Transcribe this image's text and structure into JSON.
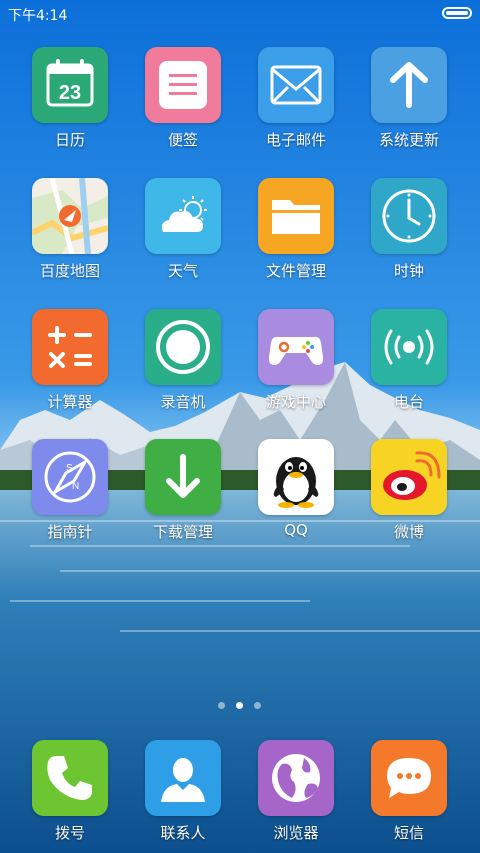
{
  "status_bar": {
    "time": "下午4:14",
    "battery_level": 1.0
  },
  "apps": [
    {
      "label": "日历",
      "icon": "calendar-icon",
      "color": "#2aa876",
      "date": "23"
    },
    {
      "label": "便签",
      "icon": "notes-icon",
      "color": "#f07b9b"
    },
    {
      "label": "电子邮件",
      "icon": "mail-icon",
      "color": "#3a9ee8"
    },
    {
      "label": "系统更新",
      "icon": "update-arrow-icon",
      "color": "#4aa0e0"
    },
    {
      "label": "百度地图",
      "icon": "map-icon",
      "color": "#ffffff"
    },
    {
      "label": "天气",
      "icon": "weather-icon",
      "color": "#3fb7e8"
    },
    {
      "label": "文件管理",
      "icon": "folder-icon",
      "color": "#f6a623"
    },
    {
      "label": "时钟",
      "icon": "clock-icon",
      "color": "#2ea7c8"
    },
    {
      "label": "计算器",
      "icon": "calculator-icon",
      "color": "#f26a2e"
    },
    {
      "label": "录音机",
      "icon": "recorder-icon",
      "color": "#2aae8a"
    },
    {
      "label": "游戏中心",
      "icon": "gamepad-icon",
      "color": "#a98ce0"
    },
    {
      "label": "电台",
      "icon": "radio-icon",
      "color": "#2ab3a2"
    },
    {
      "label": "指南针",
      "icon": "compass-icon",
      "color": "#7f8bec"
    },
    {
      "label": "下载管理",
      "icon": "download-icon",
      "color": "#3fae45"
    },
    {
      "label": "QQ",
      "icon": "qq-penguin-icon",
      "color": "#ffffff"
    },
    {
      "label": "微博",
      "icon": "weibo-icon",
      "color": "#f7d323"
    }
  ],
  "page_indicator": {
    "count": 3,
    "active": 2
  },
  "dock": [
    {
      "label": "拨号",
      "icon": "phone-icon",
      "color": "#6cc531"
    },
    {
      "label": "联系人",
      "icon": "contacts-icon",
      "color": "#2e9fe6"
    },
    {
      "label": "浏览器",
      "icon": "browser-globe-icon",
      "color": "#a565c9"
    },
    {
      "label": "短信",
      "icon": "message-icon",
      "color": "#f5792a"
    }
  ]
}
